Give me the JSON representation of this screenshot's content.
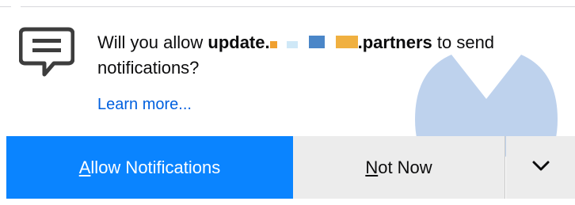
{
  "notification": {
    "message_prefix": "Will you allow ",
    "domain_start": "update.",
    "domain_end": ".partners",
    "message_suffix": " to send notifications?",
    "learn_more": "Learn more...",
    "redaction_colors": [
      "#f0a030",
      "#cfe8f7",
      "#4a86c8",
      "#f0b040"
    ]
  },
  "buttons": {
    "allow_access_key": "A",
    "allow_rest": "llow Notifications",
    "notnow_access_key": "N",
    "notnow_rest": "ot Now",
    "dropdown_icon": "chevron-down-icon"
  },
  "icons": {
    "message": "chat-bubble-icon",
    "watermark": "malwarebytes-logo"
  },
  "colors": {
    "accent": "#0a84ff",
    "link": "#0060df",
    "secondary_button": "#ececec"
  }
}
